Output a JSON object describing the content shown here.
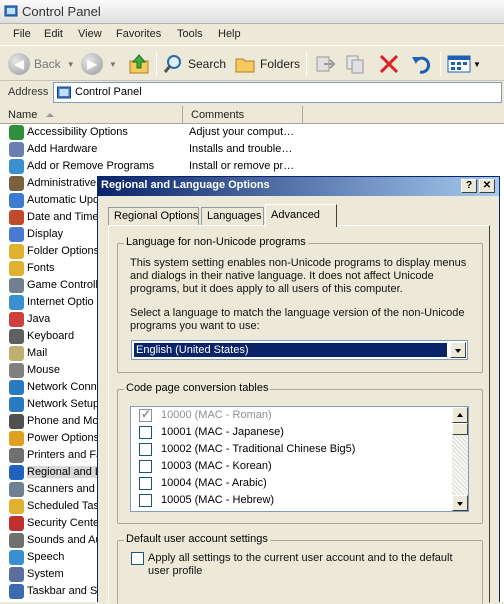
{
  "window": {
    "title": "Control Panel"
  },
  "menu": [
    "File",
    "Edit",
    "View",
    "Favorites",
    "Tools",
    "Help"
  ],
  "toolbar": {
    "back": "Back",
    "search": "Search",
    "folders": "Folders"
  },
  "address": {
    "label": "Address",
    "value": "Control Panel"
  },
  "list": {
    "columns": [
      "Name",
      "Comments"
    ],
    "items": [
      {
        "name": "Accessibility Options",
        "comment": "Adjust your comput…",
        "icon": "accessibility-icon"
      },
      {
        "name": "Add Hardware",
        "comment": "Installs and trouble…",
        "icon": "add-hardware-icon"
      },
      {
        "name": "Add or Remove Programs",
        "comment": "Install or remove pr…",
        "icon": "add-remove-programs-icon"
      },
      {
        "name": "Administrative",
        "icon": "administrative-tools-icon"
      },
      {
        "name": "Automatic Upd",
        "icon": "automatic-updates-icon"
      },
      {
        "name": "Date and Time",
        "icon": "date-time-icon"
      },
      {
        "name": "Display",
        "icon": "display-icon"
      },
      {
        "name": "Folder Options",
        "icon": "folder-options-icon"
      },
      {
        "name": "Fonts",
        "icon": "fonts-icon"
      },
      {
        "name": "Game Controlle",
        "icon": "game-controllers-icon"
      },
      {
        "name": "Internet Optio",
        "icon": "internet-options-icon"
      },
      {
        "name": "Java",
        "icon": "java-icon"
      },
      {
        "name": "Keyboard",
        "icon": "keyboard-icon"
      },
      {
        "name": "Mail",
        "icon": "mail-icon"
      },
      {
        "name": "Mouse",
        "icon": "mouse-icon"
      },
      {
        "name": "Network Conn",
        "icon": "network-connections-icon"
      },
      {
        "name": "Network Setup",
        "icon": "network-setup-icon"
      },
      {
        "name": "Phone and Mod",
        "icon": "phone-modem-icon"
      },
      {
        "name": "Power Options",
        "icon": "power-options-icon"
      },
      {
        "name": "Printers and Fa",
        "icon": "printers-faxes-icon"
      },
      {
        "name": "Regional and L",
        "icon": "regional-language-icon"
      },
      {
        "name": "Scanners and C",
        "icon": "scanners-cameras-icon"
      },
      {
        "name": "Scheduled Tas",
        "icon": "scheduled-tasks-icon"
      },
      {
        "name": "Security Cente",
        "icon": "security-center-icon"
      },
      {
        "name": "Sounds and Au",
        "icon": "sounds-audio-icon"
      },
      {
        "name": "Speech",
        "icon": "speech-icon"
      },
      {
        "name": "System",
        "icon": "system-icon"
      },
      {
        "name": "Taskbar and St",
        "icon": "taskbar-start-icon"
      }
    ]
  },
  "dialog": {
    "title": "Regional and Language Options",
    "help": "?",
    "close": "✕",
    "tabs": [
      "Regional Options",
      "Languages",
      "Advanced"
    ],
    "active_tab": "Advanced",
    "non_unicode": {
      "legend": "Language for non-Unicode programs",
      "description": "This system setting enables non-Unicode programs to display menus and dialogs in their native language. It does not affect Unicode programs, but it does apply to all users of this computer.",
      "prompt": "Select a language to match the language version of the non-Unicode programs you want to use:",
      "selected": "English (United States)"
    },
    "code_pages": {
      "legend": "Code page conversion tables",
      "items": [
        {
          "label": "10000 (MAC - Roman)",
          "checked": true
        },
        {
          "label": "10001 (MAC - Japanese)",
          "checked": false
        },
        {
          "label": "10002 (MAC - Traditional Chinese Big5)",
          "checked": false
        },
        {
          "label": "10003 (MAC - Korean)",
          "checked": false
        },
        {
          "label": "10004 (MAC - Arabic)",
          "checked": false
        },
        {
          "label": "10005 (MAC - Hebrew)",
          "checked": false
        }
      ]
    },
    "default_user": {
      "legend": "Default user account settings",
      "option": "Apply all settings to the current user account and to the default user profile"
    }
  },
  "colors": {
    "dialog_title_start": "#0a246a",
    "dialog_title_end": "#a6caf0",
    "selection": "#0a246a"
  }
}
